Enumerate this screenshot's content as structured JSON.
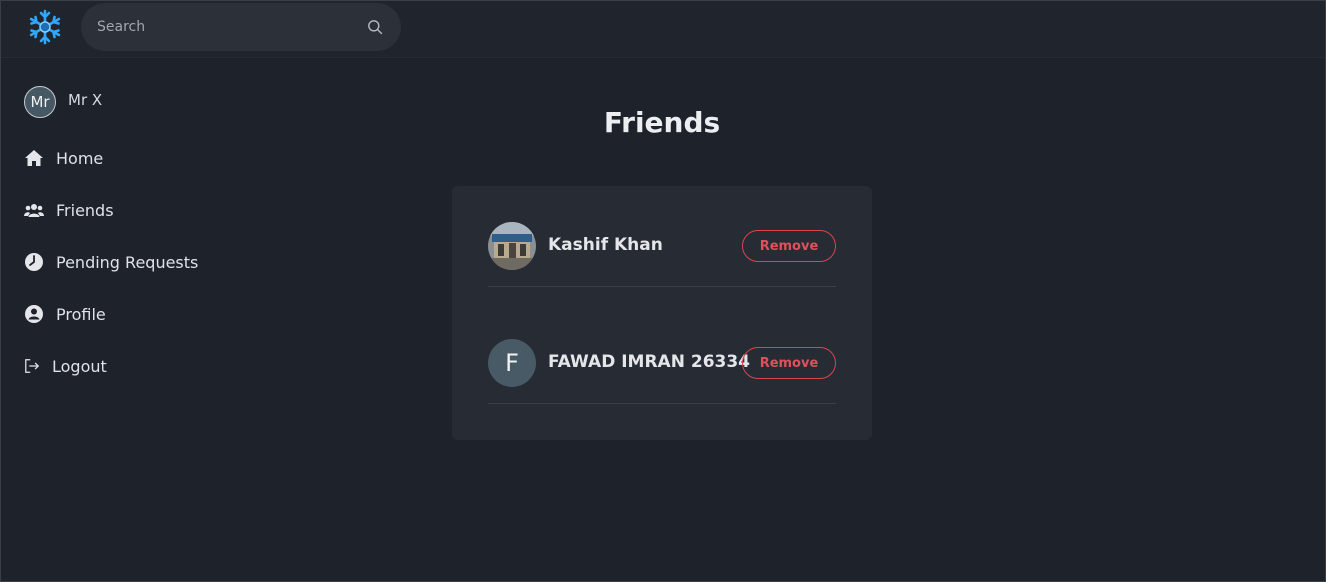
{
  "header": {
    "logo_icon": "snowflake-icon",
    "search": {
      "placeholder": "Search",
      "value": ""
    }
  },
  "sidebar": {
    "user": {
      "initials": "Mr",
      "name": "Mr X"
    },
    "items": [
      {
        "label": "Home",
        "icon": "home-icon"
      },
      {
        "label": "Friends",
        "icon": "users-icon"
      },
      {
        "label": "Pending Requests",
        "icon": "clock-icon"
      },
      {
        "label": "Profile",
        "icon": "user-circle-icon"
      },
      {
        "label": "Logout",
        "icon": "logout-icon"
      }
    ]
  },
  "main": {
    "title": "Friends",
    "friends": [
      {
        "name": "Kashif Khan",
        "avatar": "photo",
        "action": "Remove"
      },
      {
        "name": "FAWAD IMRAN 26334",
        "avatar_letter": "F",
        "action": "Remove"
      }
    ]
  },
  "colors": {
    "background": "#1e222b",
    "card": "#262b34",
    "accent_danger": "#e0505b",
    "logo": "#2ea7ff"
  }
}
